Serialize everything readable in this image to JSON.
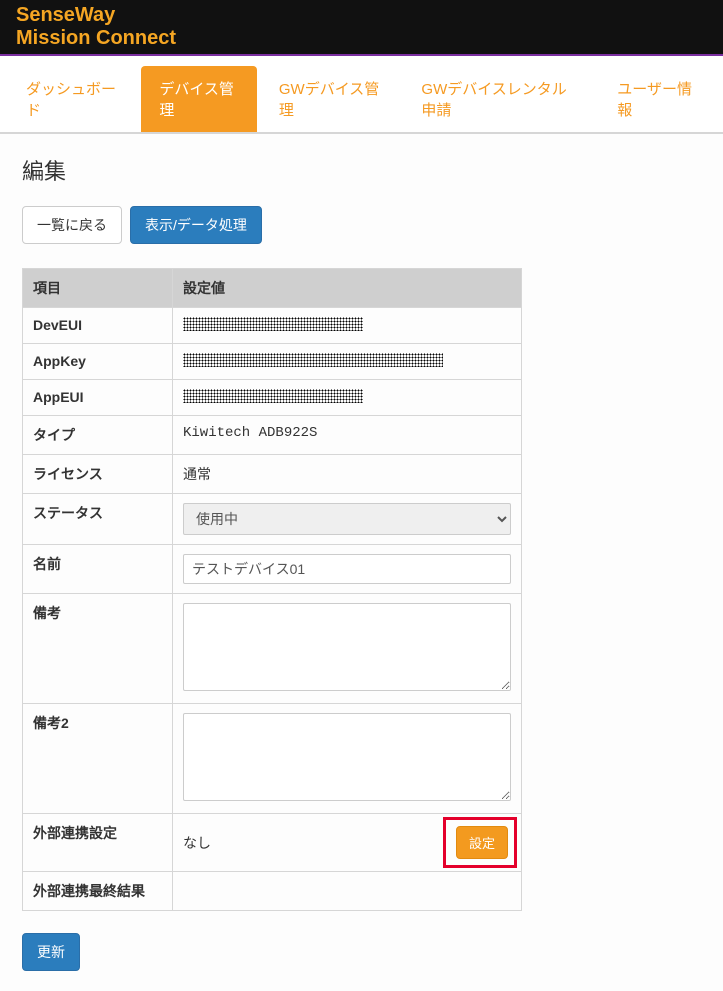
{
  "brand": {
    "line1": "SenseWay",
    "line2": "Mission Connect"
  },
  "tabs": [
    {
      "label": "ダッシュボード"
    },
    {
      "label": "デバイス管理"
    },
    {
      "label": "GWデバイス管理"
    },
    {
      "label": "GWデバイスレンタル申請"
    },
    {
      "label": "ユーザー情報"
    }
  ],
  "page_title": "編集",
  "buttons": {
    "back_list": "一覧に戻る",
    "view_data": "表示/データ処理",
    "configure": "設定",
    "update": "更新"
  },
  "headers": {
    "item": "項目",
    "value": "設定値"
  },
  "rows": {
    "deveui": "DevEUI",
    "appkey": "AppKey",
    "appeui": "AppEUI",
    "type": "タイプ",
    "license": "ライセンス",
    "status": "ステータス",
    "name": "名前",
    "remarks": "備考",
    "remarks2": "備考2",
    "ext_link": "外部連携設定",
    "ext_result": "外部連携最終結果"
  },
  "values": {
    "type": "Kiwitech ADB922S",
    "license": "通常",
    "status_selected": "使用中",
    "name": "テストデバイス01",
    "remarks": "",
    "remarks2": "",
    "ext_link": "なし",
    "ext_result": ""
  }
}
